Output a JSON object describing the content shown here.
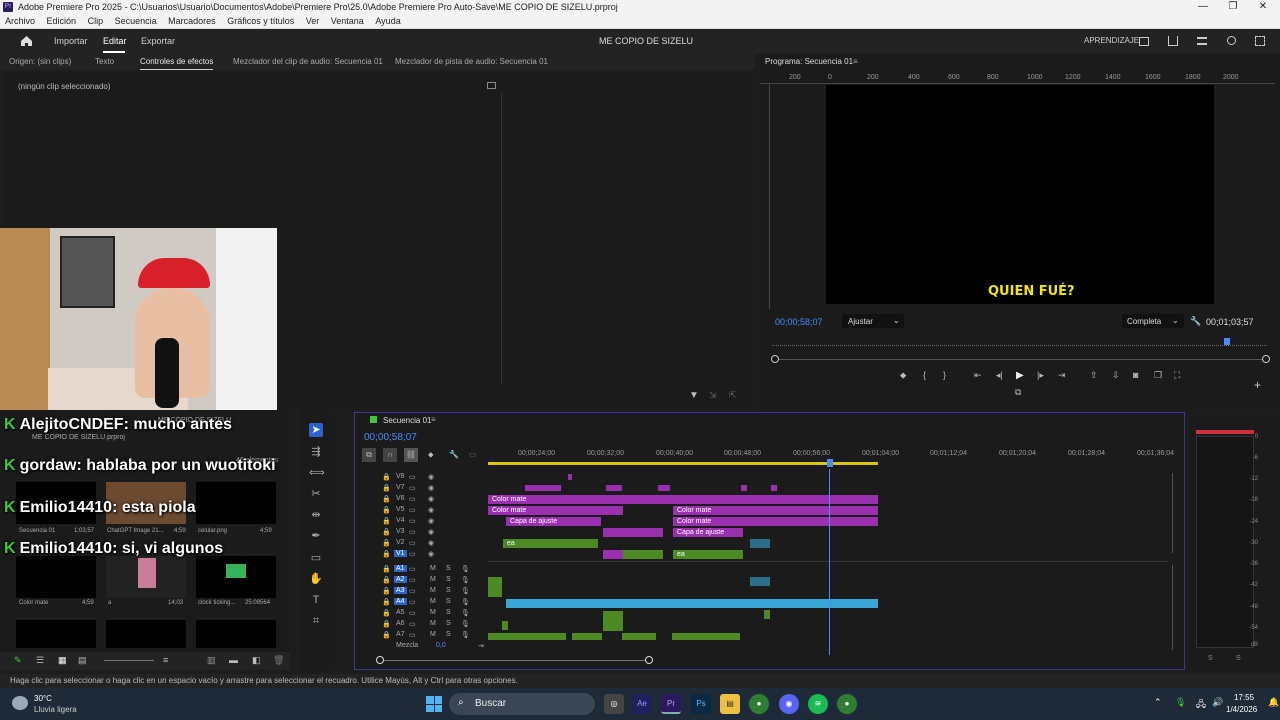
{
  "window": {
    "title": "Adobe Premiere Pro 2025 - C:\\Usuarios\\Usuario\\Documentos\\Adobe\\Premiere Pro\\25.0\\Adobe Premiere Pro Auto-Save\\ME COPIO DE SIZELU.prproj",
    "logo": "Pr",
    "minimize": "—",
    "restore": "❐",
    "close": "✕"
  },
  "menu": [
    "Archivo",
    "Edición",
    "Clip",
    "Secuencia",
    "Marcadores",
    "Gráficos y títulos",
    "Ver",
    "Ventana",
    "Ayuda"
  ],
  "header": {
    "import": "Importar",
    "edit": "Editar",
    "export": "Exportar",
    "project_title": "ME COPIO DE SIZELU",
    "learning": "APRENDIZAJE"
  },
  "panels": {
    "source": "Origen: (sin clips)",
    "text": "Texto",
    "effect_controls": "Controles de efectos",
    "audio_clip_mixer": "Mezclador del clip de audio: Secuencia 01",
    "audio_track_mixer": "Mezclador de pista de audio: Secuencia 01",
    "no_clip": "(ningún clip seleccionado)"
  },
  "program": {
    "title": "Programa: Secuencia 01",
    "ruler": [
      "200",
      "0",
      "200",
      "400",
      "600",
      "800",
      "1000",
      "1200",
      "1400",
      "1600",
      "1800",
      "2000"
    ],
    "caption": "QUIEN FUÉ?",
    "timecode": "00;00;58;07",
    "fit": "Ajustar",
    "quality": "Completa",
    "duration": "00;01;03;57",
    "playhead_fraction": 0.92
  },
  "project": {
    "title": "ME COPIO DE SIZELU",
    "file": "ME COPIO DE SIZELU.prproj",
    "count": "46 elementos",
    "items": [
      {
        "name": "Secuencia 01",
        "dur": "1;03;57"
      },
      {
        "name": "ChatGPT Image 21...",
        "dur": "4;59"
      },
      {
        "name": "celular.png",
        "dur": "4;59"
      },
      {
        "name": "Color mate",
        "dur": "4;59"
      },
      {
        "name": "a",
        "dur": "14;03"
      },
      {
        "name": "clock ticking...",
        "dur": "25:09564"
      }
    ]
  },
  "chat": [
    {
      "user": "AlejitoCNDEF",
      "msg": ": mucho antes"
    },
    {
      "user": "gordaw",
      "msg": ": hablaba por un wuotitoki"
    },
    {
      "user": "Emilio14410",
      "msg": ": esta piola"
    },
    {
      "user": "Emilio14410",
      "msg": ": si, vi algunos"
    }
  ],
  "timeline": {
    "sequence": "Secuencia 01",
    "timecode": "00;00;58;07",
    "ruler": [
      "00;00;24;00",
      "00;00;32;00",
      "00;00;40;00",
      "00;00;48;00",
      "00;00;56;00",
      "00;01;04;00",
      "00;01;12;04",
      "00;01;20;04",
      "00;01;28;04",
      "00;01;36;04"
    ],
    "video_tracks": [
      "V8",
      "V7",
      "V6",
      "V5",
      "V4",
      "V3",
      "V2",
      "V1"
    ],
    "audio_tracks": [
      "A1",
      "A2",
      "A3",
      "A4",
      "A5",
      "A6",
      "A7"
    ],
    "mix_label": "Mezcla",
    "mix_value": "0,0",
    "clip_color_mate": "Color mate",
    "clip_adjust": "Capa de ajuste",
    "clip_ea": "ea",
    "fx": "fx"
  },
  "meter": {
    "scale": [
      "0",
      "-6",
      "-12",
      "-18",
      "-24",
      "-30",
      "-36",
      "-42",
      "-48",
      "-54",
      "dB"
    ],
    "s": "S"
  },
  "status": "Haga clic para seleccionar o haga clic en un espacio vacío y arrastre para seleccionar el recuadro. Utilice Mayús, Alt y Ctrl para otras opciones.",
  "taskbar": {
    "temp": "30°C",
    "weather": "Lluvia ligera",
    "search": "Buscar",
    "time": "17:55",
    "date": "1/4/2026"
  },
  "colors": {
    "accent": "#4a8cff",
    "purple": "#9a2fb0",
    "green": "#4d8a23",
    "blue": "#3aa6d8",
    "caption": "#f2e60a"
  }
}
